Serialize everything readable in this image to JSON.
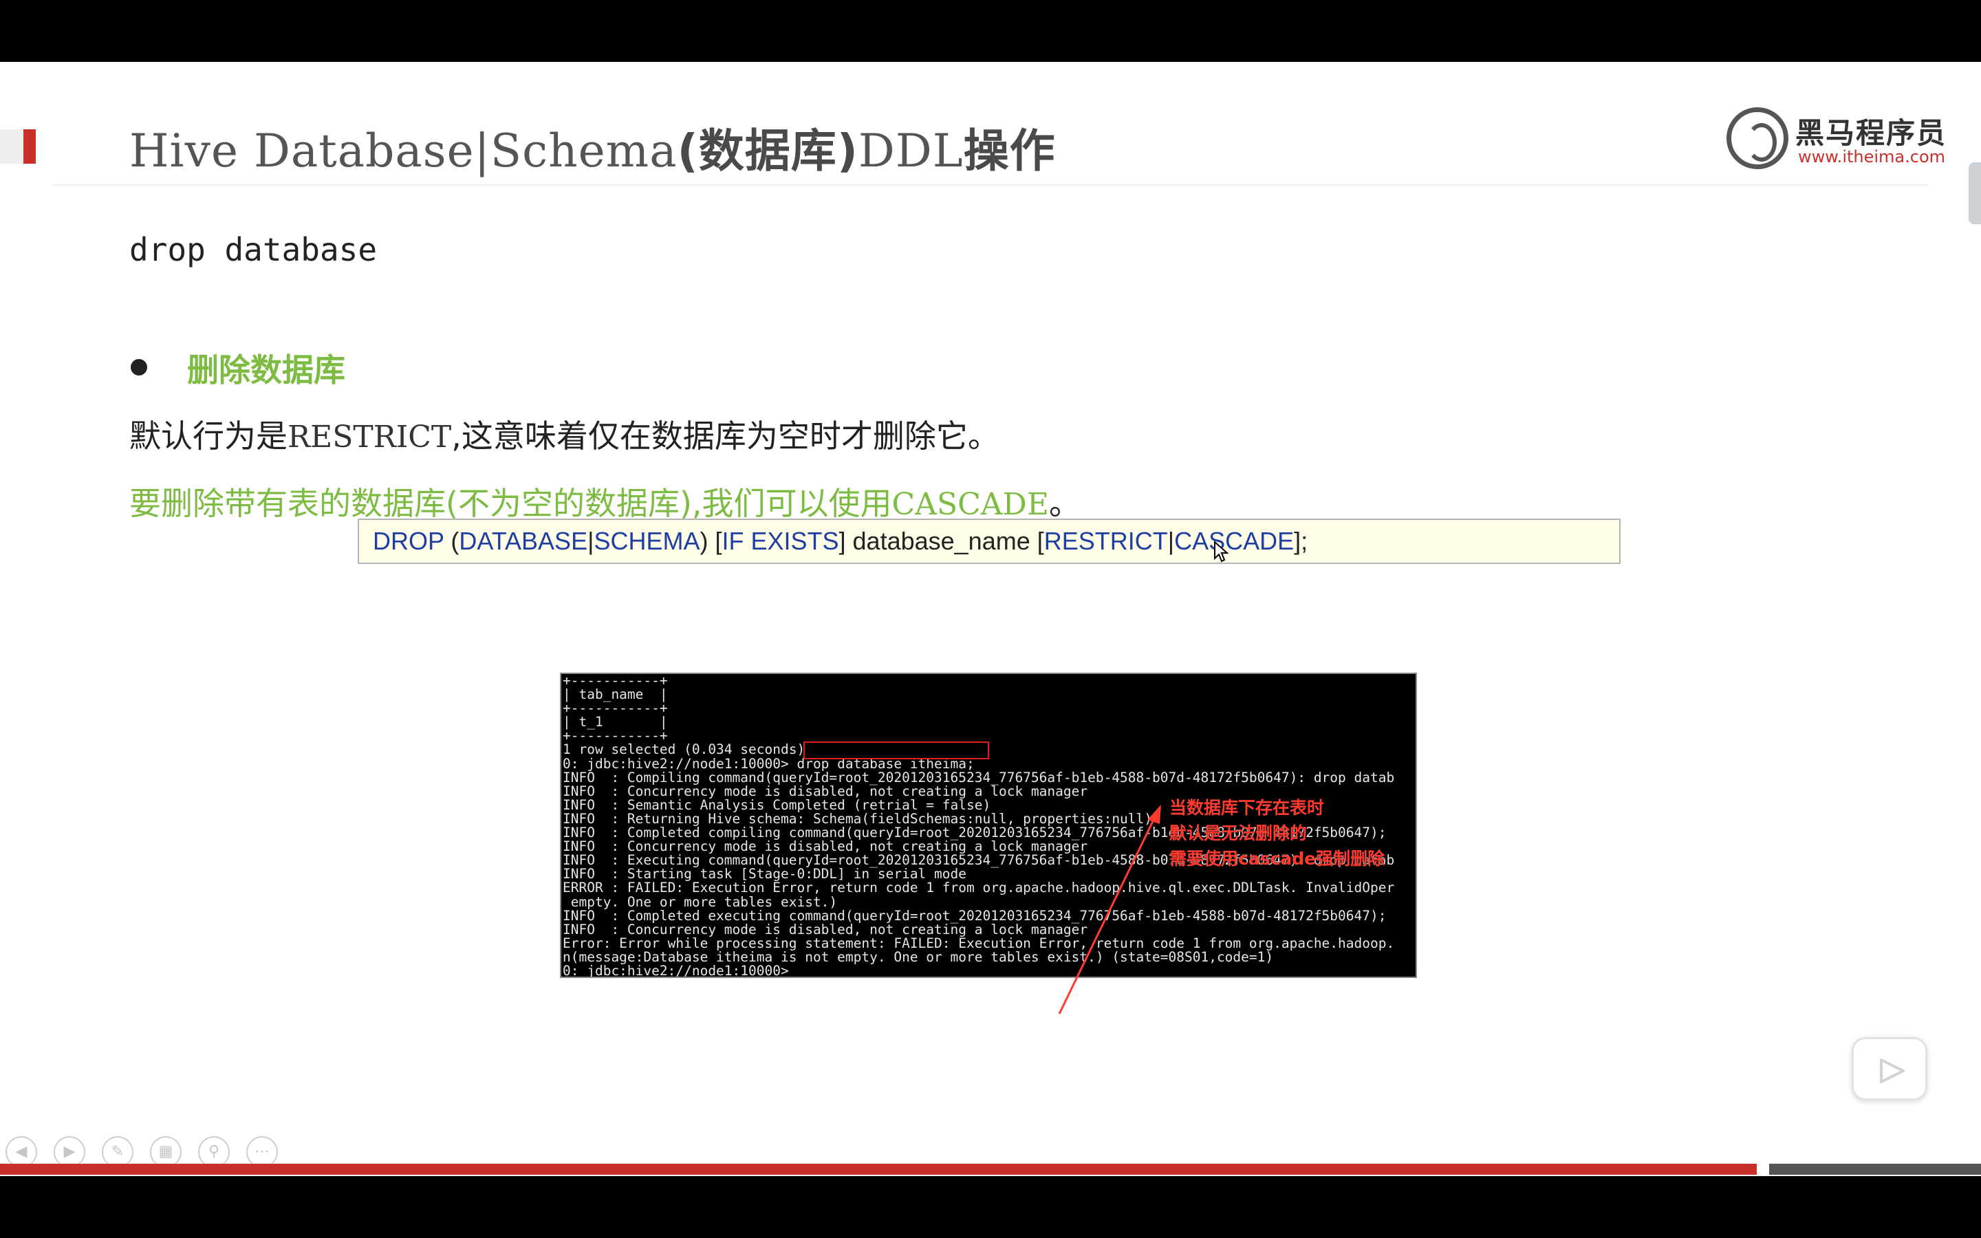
{
  "slide": {
    "title_prefix": "Hive Database|Schema",
    "title_cn": "(数据库)",
    "title_ddl": "DDL",
    "title_suffix": "操作",
    "logo_text": "黑马程序员",
    "logo_url": "www.itheima.com",
    "subheading": "drop database",
    "bullet": "删除数据库",
    "line1_a": "默认行为是",
    "line1_kw": "RESTRICT",
    "line1_b": ",这意味着仅在数据库为空时才删除它。",
    "line2_a": "要删除带有表的数据库(不为空的数据库),我们可以使用",
    "line2_kw": "CASCADE",
    "line2_end": "。"
  },
  "syntax": {
    "drop": "DROP",
    "open_paren": " (",
    "database": "DATABASE",
    "bar1": "|",
    "schema": "SCHEMA",
    "close_paren_bracket": ") [",
    "if_exists": "IF EXISTS",
    "mid": "] database_name [",
    "restrict": "RESTRICT",
    "bar2": "|",
    "cascade": "CASCADE",
    "end": "];"
  },
  "terminal": {
    "lines": "+-----------+\n| tab_name  |\n+-----------+\n| t_1       |\n+-----------+\n1 row selected (0.034 seconds)\n0: jdbc:hive2://node1:10000> drop database itheima;\nINFO  : Compiling command(queryId=root_20201203165234_776756af-b1eb-4588-b07d-48172f5b0647): drop datab\nINFO  : Concurrency mode is disabled, not creating a lock manager\nINFO  : Semantic Analysis Completed (retrial = false)\nINFO  : Returning Hive schema: Schema(fieldSchemas:null, properties:null)\nINFO  : Completed compiling command(queryId=root_20201203165234_776756af-b1eb-4588-b07d-48172f5b0647);\nINFO  : Concurrency mode is disabled, not creating a lock manager\nINFO  : Executing command(queryId=root_20201203165234_776756af-b1eb-4588-b07d-48172f5b0647): drop datab\nINFO  : Starting task [Stage-0:DDL] in serial mode\nERROR : FAILED: Execution Error, return code 1 from org.apache.hadoop.hive.ql.exec.DDLTask. InvalidOper\n empty. One or more tables exist.)\nINFO  : Completed executing command(queryId=root_20201203165234_776756af-b1eb-4588-b07d-48172f5b0647);\nINFO  : Concurrency mode is disabled, not creating a lock manager\nError: Error while processing statement: FAILED: Execution Error, return code 1 from org.apache.hadoop.\nn(message:Database itheima is not empty. One or more tables exist.) (state=08S01,code=1)\n0: jdbc:hive2://node1:10000>",
    "annotation_1": "当数据库下存在表时",
    "annotation_2": "默认是无法删除的",
    "annotation_3": "需要使用cascade强制删除"
  },
  "colors": {
    "accent_red": "#c8302a",
    "bullet_green": "#7dbb43",
    "keyword_blue": "#1d3fa1",
    "annotation_red": "#ff3b30"
  },
  "icons": {
    "play": "play-icon",
    "nav": [
      "prev-icon",
      "next-icon",
      "pen-icon",
      "slides-icon",
      "zoom-icon",
      "more-icon"
    ]
  }
}
